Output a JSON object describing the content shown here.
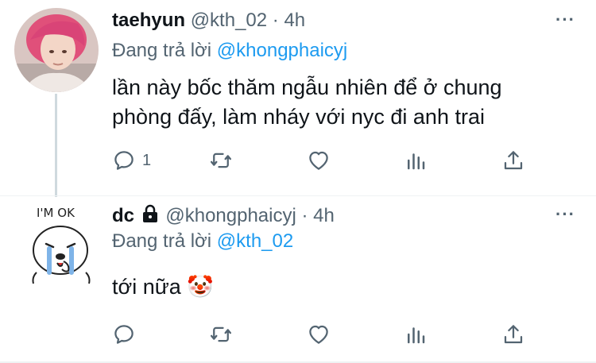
{
  "tweets": [
    {
      "name": "taehyun",
      "handle": "@kth_02",
      "separator": "·",
      "time": "4h",
      "replying_prefix": "Đang trả lời",
      "replying_to": "@khongphaicyj",
      "text_line1": "lần này bốc thăm ngẫu nhiên để ở chung",
      "text_line2": "phòng đấy, làm nháy với nyc đi anh trai",
      "reply_count": "1",
      "avatar_icon": "profile-photo-pink-hair"
    },
    {
      "name": "dc",
      "lock_icon": "lock-icon",
      "handle": "@khongphaicyj",
      "separator": "·",
      "time": "4h",
      "replying_prefix": "Đang trả lời",
      "replying_to": "@kth_02",
      "text": "tới nữa",
      "emoji": "🤡",
      "avatar_caption": "I'M OK",
      "avatar_icon": "crying-sticker-avatar"
    }
  ],
  "more_glyph": "···",
  "colors": {
    "accent": "#1d9bf0",
    "secondary": "#536471",
    "primary": "#0f1419",
    "thread_line": "#cfd9de"
  }
}
